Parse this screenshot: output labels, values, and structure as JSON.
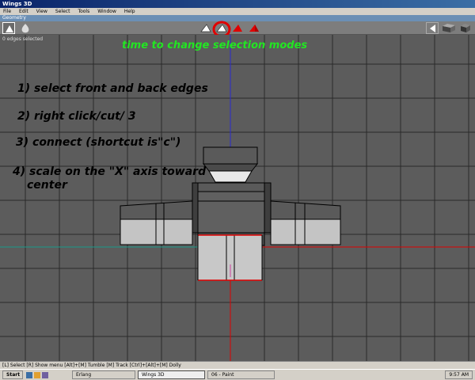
{
  "window": {
    "title": "Wings 3D"
  },
  "menu": [
    "File",
    "Edit",
    "View",
    "Select",
    "Tools",
    "Window",
    "Help"
  ],
  "geometry_label": "Geometry",
  "viewport": {
    "status": "0 edges selected"
  },
  "annotations": {
    "mode_caption": "time to change selection modes",
    "step1": "1) select front and back edges",
    "step2": "2) right click/cut/ 3",
    "step3": "3) connect (shortcut is\"c\")",
    "step4_line1": "4) scale on the \"X\" axis toward",
    "step4_line2": "center"
  },
  "help_line": "[L] Select  [R] Show menu  [Alt]+[M] Tumble  [M] Track  [Ctrl]+[Alt]+[M] Dolly",
  "taskbar": {
    "start": "Start",
    "tasks": [
      "Erlang",
      "Wings 3D",
      "06 - Paint"
    ],
    "clock": "9:57 AM"
  },
  "colors": {
    "caption": "#22e622",
    "highlight": "#e00000",
    "axis_x": "#e00000",
    "axis_z": "#2a2ad0",
    "axis_y_ghost": "#1a9a8a"
  }
}
